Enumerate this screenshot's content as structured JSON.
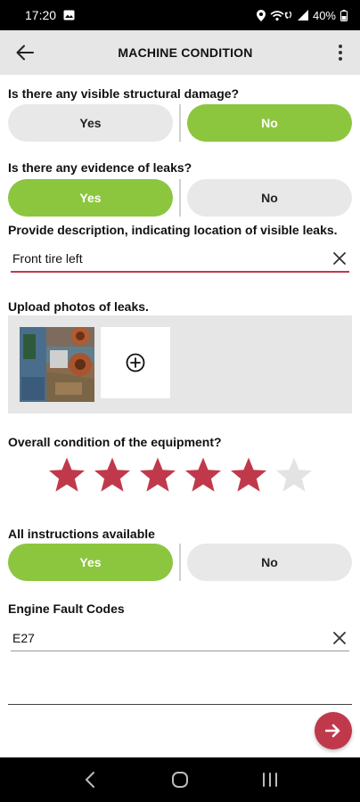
{
  "status_bar": {
    "time": "17:20",
    "battery": "40%",
    "icons": [
      "image-icon",
      "location-icon",
      "wifi-calling-icon",
      "signal-icon",
      "battery-icon"
    ]
  },
  "app_bar": {
    "title": "MACHINE CONDITION",
    "back_icon": "arrow-back-icon",
    "more_icon": "more-vertical-icon"
  },
  "questions": {
    "structural_damage": {
      "label": "Is there any visible structural damage?",
      "options": [
        "Yes",
        "No"
      ],
      "selected": "No"
    },
    "leaks": {
      "label": "Is there any evidence of leaks?",
      "options": [
        "Yes",
        "No"
      ],
      "selected": "Yes"
    },
    "leak_description": {
      "label": "Provide description, indicating location of visible leaks.",
      "value": "Front tire left"
    },
    "leak_photos": {
      "label": "Upload photos of leaks.",
      "photo_count": 1,
      "add_icon": "add-circle-icon"
    },
    "overall_condition": {
      "label": "Overall condition of the equipment?",
      "rating": 5,
      "max_rating": 6,
      "active_color": "#c0394b",
      "inactive_color": "#e3e3e3"
    },
    "instructions": {
      "label": "All instructions available",
      "options": [
        "Yes",
        "No"
      ],
      "selected": "Yes"
    },
    "fault_codes": {
      "label": "Engine Fault Codes",
      "value": "E27"
    }
  },
  "fab": {
    "icon": "arrow-forward-icon",
    "color": "#c0394b"
  },
  "colors": {
    "accent_green": "#8cc63f",
    "accent_red": "#c0394b"
  },
  "nav_bar": {
    "icons": [
      "back-nav-icon",
      "home-nav-icon",
      "recents-nav-icon"
    ]
  }
}
